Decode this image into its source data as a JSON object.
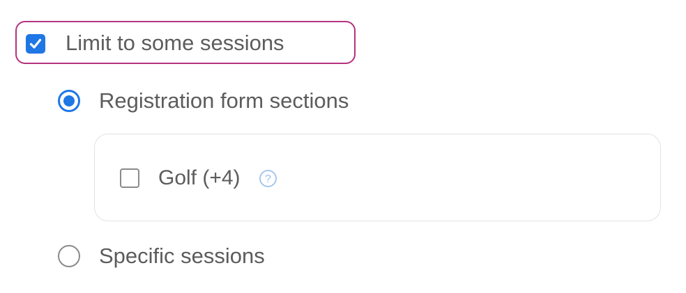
{
  "limit": {
    "label": "Limit to some sessions",
    "checked": true,
    "accent_color": "#1f77e5",
    "highlight_color": "#b5327f"
  },
  "options": {
    "registration": {
      "label": "Registration form sections",
      "selected": true
    },
    "specific": {
      "label": "Specific sessions",
      "selected": false
    }
  },
  "sections": {
    "items": [
      {
        "label": "Golf (+4)",
        "checked": false,
        "icon": "question-mark-icon"
      }
    ]
  }
}
